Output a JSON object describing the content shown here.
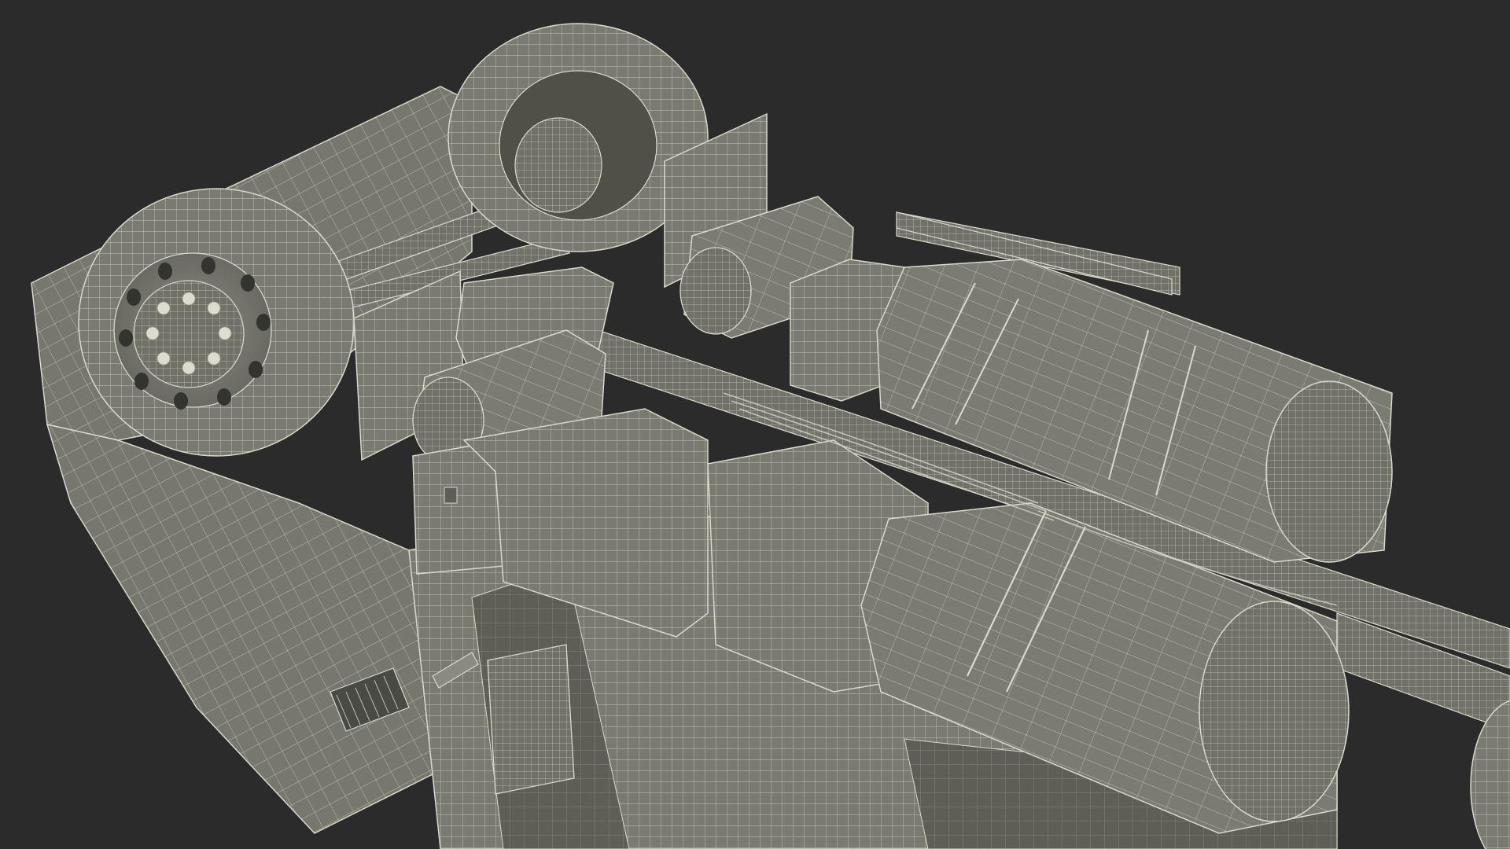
{
  "scene": {
    "subject": "truck-chassis-underside-wireframe",
    "colors": {
      "background": "#2b2b2b",
      "surface": "#7a7a70",
      "surface_dark": "#5e5e56",
      "surface_light": "#8c8c82",
      "wire": "#d8d8cc",
      "shadow": "#1e1e1c"
    }
  }
}
